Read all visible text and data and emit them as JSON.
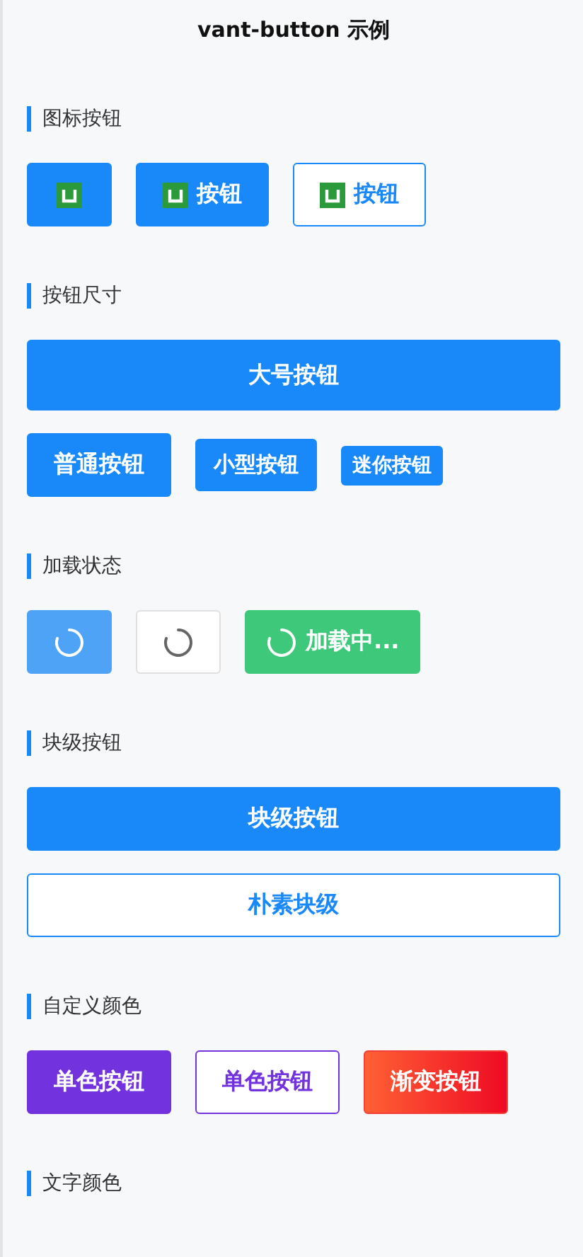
{
  "title": "vant-button 示例",
  "sections": [
    {
      "heading": "图标按钮",
      "buttons": [
        {
          "kind": "primary",
          "icon": true
        },
        {
          "kind": "primary",
          "icon": true,
          "label": "按钮"
        },
        {
          "kind": "plain",
          "icon": true,
          "label": "按钮"
        }
      ]
    },
    {
      "heading": "按钮尺寸",
      "buttons": [
        {
          "kind": "large",
          "block": true,
          "label": "大号按钮"
        },
        {
          "kind": "primary",
          "label": "普通按钮"
        },
        {
          "kind": "small",
          "label": "小型按钮"
        },
        {
          "kind": "mini",
          "label": "迷你按钮"
        }
      ]
    },
    {
      "heading": "加载状态",
      "buttons": [
        {
          "kind": "primary",
          "loading": true
        },
        {
          "kind": "default",
          "loading": true
        },
        {
          "kind": "success",
          "loading": true,
          "label": "加载中..."
        }
      ]
    },
    {
      "heading": "块级按钮",
      "buttons": [
        {
          "kind": "primary",
          "block": true,
          "label": "块级按钮"
        },
        {
          "kind": "plain",
          "block": true,
          "label": "朴素块级"
        }
      ]
    },
    {
      "heading": "自定义颜色",
      "buttons": [
        {
          "kind": "primary",
          "color": "#7232dd",
          "label": "单色按钮"
        },
        {
          "kind": "plain",
          "color": "#7232dd",
          "label": "单色按钮"
        },
        {
          "kind": "gradient",
          "label": "渐变按钮"
        }
      ]
    },
    {
      "heading": "文字颜色"
    }
  ]
}
